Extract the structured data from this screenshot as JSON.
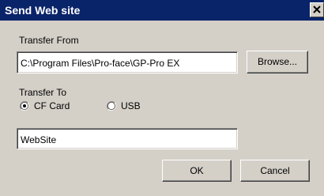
{
  "dialog": {
    "title": "Send Web site",
    "close_label": "×"
  },
  "transfer_from": {
    "label": "Transfer From",
    "path_value": "C:\\Program Files\\Pro-face\\GP-Pro EX",
    "browse_label": "Browse..."
  },
  "transfer_to": {
    "label": "Transfer To",
    "options": [
      {
        "label": "CF Card",
        "selected": true
      },
      {
        "label": "USB",
        "selected": false
      }
    ],
    "folder_value": "WebSite"
  },
  "actions": {
    "ok_label": "OK",
    "cancel_label": "Cancel"
  }
}
